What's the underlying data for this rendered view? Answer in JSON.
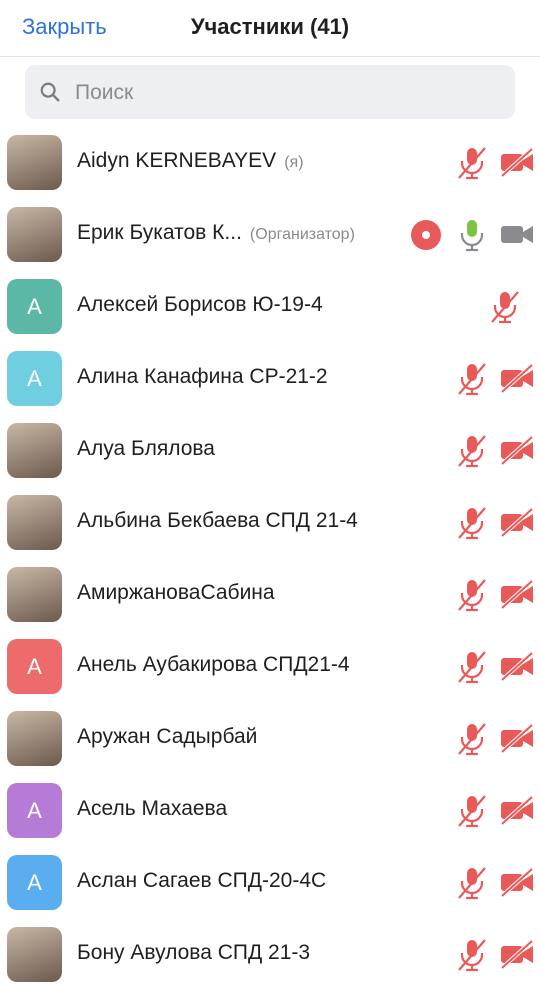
{
  "header": {
    "close_label": "Закрыть",
    "title": "Участники (41)"
  },
  "search": {
    "placeholder": "Поиск"
  },
  "colors": {
    "accent": "#2d73d9",
    "muted_red": "#e85a5a",
    "mic_on_green": "#7cc243",
    "cam_on_gray": "#8a8a8f"
  },
  "participants": [
    {
      "name": "Aidyn KERNEBAYEV",
      "role": "(я)",
      "avatar": "photo",
      "mic": "muted",
      "cam": "off"
    },
    {
      "name": "Ерик Букатов К...",
      "role": "(Организатор)",
      "avatar": "photo",
      "mic": "on",
      "cam": "on",
      "recording": true
    },
    {
      "name": "Алексей Борисов Ю-19-4",
      "role": "",
      "avatar": "letter",
      "initial": "A",
      "color": "#5bb8a6",
      "mic": "muted",
      "cam": "none"
    },
    {
      "name": "Алина Канафина СР-21-2",
      "role": "",
      "avatar": "letter",
      "initial": "A",
      "color": "#6fcfe0",
      "mic": "muted",
      "cam": "off"
    },
    {
      "name": "Алуа Блялова",
      "role": "",
      "avatar": "photo",
      "mic": "muted",
      "cam": "off"
    },
    {
      "name": "Альбина Бекбаева СПД 21-4",
      "role": "",
      "avatar": "photo",
      "mic": "muted",
      "cam": "off"
    },
    {
      "name": "АмиржановаСабина",
      "role": "",
      "avatar": "photo",
      "mic": "muted",
      "cam": "off"
    },
    {
      "name": "Анель Аубакирова СПД21-4",
      "role": "",
      "avatar": "letter",
      "initial": "A",
      "color": "#ee6b6b",
      "mic": "muted",
      "cam": "off"
    },
    {
      "name": "Аружан Садырбай",
      "role": "",
      "avatar": "photo",
      "mic": "muted",
      "cam": "off"
    },
    {
      "name": "Асель Махаева",
      "role": "",
      "avatar": "letter",
      "initial": "A",
      "color": "#b57bd6",
      "mic": "muted",
      "cam": "off"
    },
    {
      "name": "Аслан Сагаев СПД-20-4С",
      "role": "",
      "avatar": "letter",
      "initial": "A",
      "color": "#5aaef0",
      "mic": "muted",
      "cam": "off"
    },
    {
      "name": "Бону Авулова СПД 21-3",
      "role": "",
      "avatar": "photo",
      "mic": "muted",
      "cam": "off"
    }
  ]
}
